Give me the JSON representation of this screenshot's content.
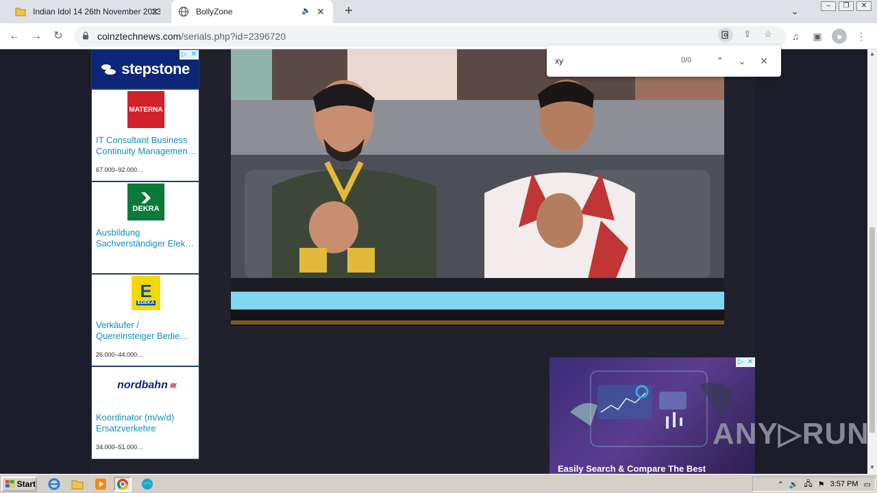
{
  "browser": {
    "tabs": [
      {
        "title": "Indian Idol 14 26th November 2023 |",
        "active": false
      },
      {
        "title": "BollyZone",
        "active": true
      }
    ],
    "new_tab_label": "+",
    "url_host": "coinztechnews.com",
    "url_path": "/serials.php?id=2396720"
  },
  "find_bar": {
    "query": "xy",
    "count": "0/0"
  },
  "left_ad": {
    "brand": "stepstone",
    "jobs": [
      {
        "logo_text": "MATERNA",
        "logo_color": "#d0202a",
        "title": "IT Consultant Business Continuity Managemen…",
        "title_l1": "IT Consultant Business",
        "title_l2": "Continuity Managemen…",
        "salary": "67.000–92.000…"
      },
      {
        "logo_text": "DEKRA",
        "logo_color": "#0a7a3a",
        "title_l1": "Ausbildung",
        "title_l2": "Sachverständiger Elek…",
        "salary": ""
      },
      {
        "logo_text": "EDEKA",
        "logo_color": "#f5d800",
        "title_l1": "Verkäufer /",
        "title_l2": "Quereinsteiger Bedie…",
        "salary": "26.000–44.000…"
      },
      {
        "logo_text": "nordbahn",
        "logo_color": "#ffffff",
        "title_l1": "Koordinator (m/w/d)",
        "title_l2": "Ersatzverkehre",
        "salary": "34.000–51.000…"
      }
    ]
  },
  "br_ad": {
    "headline": "Easily Search & Compare The Best"
  },
  "watermark": "ANY▷RUN",
  "taskbar": {
    "start_label": "Start",
    "time": "3:57 PM"
  },
  "colors": {
    "page_bg": "#1c1c2a",
    "stepstone_blue": "#0c2577",
    "ad_link": "#0a8fb8"
  }
}
